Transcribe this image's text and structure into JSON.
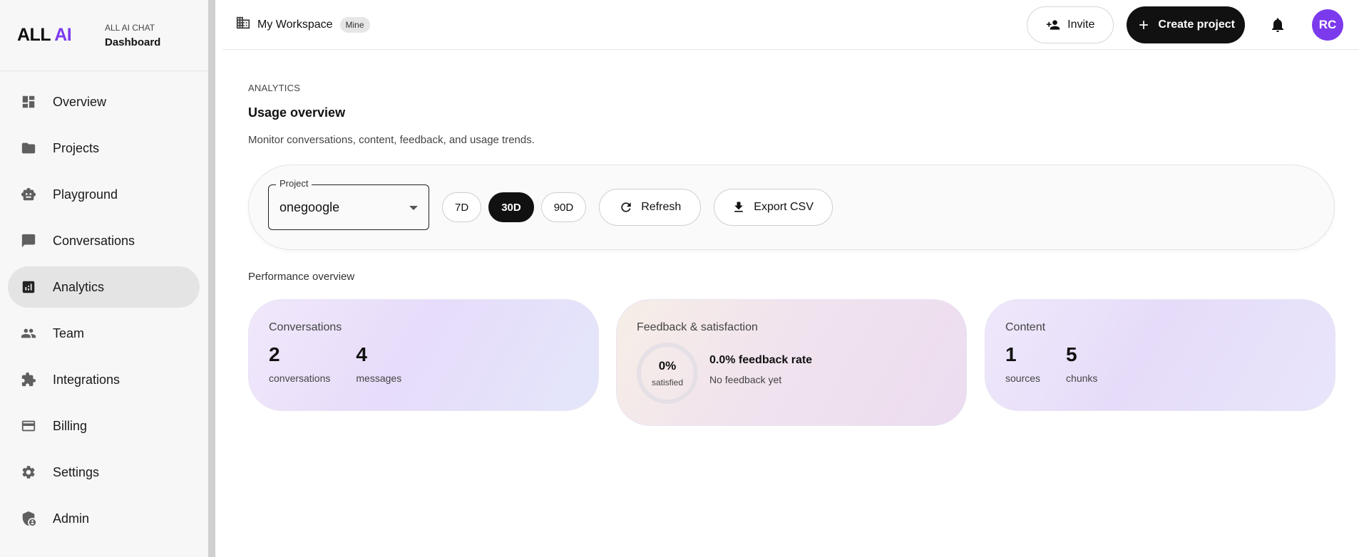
{
  "brand": {
    "logo_main": "ALL",
    "logo_accent": "AI",
    "subtitle": "ALL AI CHAT",
    "title": "Dashboard",
    "accent_color": "#7c3aed"
  },
  "sidebar": {
    "items": [
      {
        "label": "Overview",
        "icon": "dashboard-icon",
        "active": false
      },
      {
        "label": "Projects",
        "icon": "folder-icon",
        "active": false
      },
      {
        "label": "Playground",
        "icon": "robot-icon",
        "active": false
      },
      {
        "label": "Conversations",
        "icon": "chat-icon",
        "active": false
      },
      {
        "label": "Analytics",
        "icon": "analytics-icon",
        "active": true
      },
      {
        "label": "Team",
        "icon": "people-icon",
        "active": false
      },
      {
        "label": "Integrations",
        "icon": "puzzle-icon",
        "active": false
      },
      {
        "label": "Billing",
        "icon": "credit-card-icon",
        "active": false
      },
      {
        "label": "Settings",
        "icon": "gear-icon",
        "active": false
      },
      {
        "label": "Admin",
        "icon": "admin-shield-icon",
        "active": false
      }
    ]
  },
  "topbar": {
    "workspace_name": "My Workspace",
    "workspace_badge": "Mine",
    "invite_label": "Invite",
    "create_label": "Create project",
    "avatar_initials": "RC"
  },
  "main": {
    "eyebrow": "ANALYTICS",
    "title": "Usage overview",
    "description": "Monitor conversations, content, feedback, and usage trends."
  },
  "filters": {
    "project_label": "Project",
    "project_value": "onegoogle",
    "ranges": [
      {
        "label": "7D",
        "active": false
      },
      {
        "label": "30D",
        "active": true
      },
      {
        "label": "90D",
        "active": false
      }
    ],
    "refresh_label": "Refresh",
    "export_label": "Export CSV"
  },
  "performance": {
    "section_title": "Performance overview",
    "conversations": {
      "title": "Conversations",
      "stats": [
        {
          "value": "2",
          "label": "conversations"
        },
        {
          "value": "4",
          "label": "messages"
        }
      ]
    },
    "feedback": {
      "title": "Feedback & satisfaction",
      "ring_value": "0%",
      "ring_label": "satisfied",
      "satisfied_fraction": 0,
      "rate": "0.0% feedback rate",
      "note": "No feedback yet"
    },
    "content": {
      "title": "Content",
      "stats": [
        {
          "value": "1",
          "label": "sources"
        },
        {
          "value": "5",
          "label": "chunks"
        }
      ]
    }
  }
}
